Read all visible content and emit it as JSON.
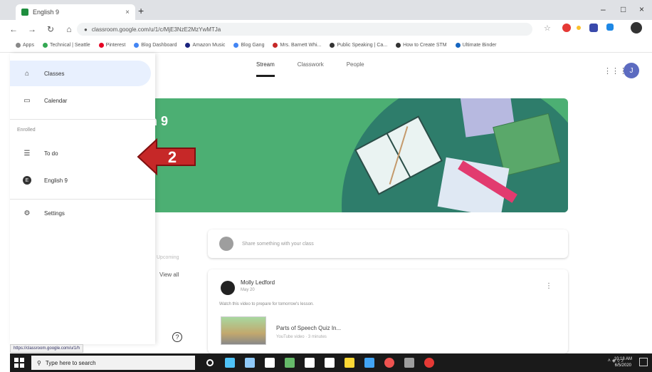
{
  "browser": {
    "tab_title": "English 9",
    "tab_close": "×",
    "new_tab": "+",
    "url": "classroom.google.com/u/1/c/MjE3NzE2MzYwMTJa",
    "bookmarks": [
      {
        "label": "Apps",
        "color": "#888888"
      },
      {
        "label": "Technical | Seattle",
        "color": "#34a853"
      },
      {
        "label": "Pinterest",
        "color": "#e60023"
      },
      {
        "label": "Blog Dashboard",
        "color": "#4285f4"
      },
      {
        "label": "Amazon Music",
        "color": "#1a237e"
      },
      {
        "label": "Blog Gang",
        "color": "#4285f4"
      },
      {
        "label": "Mrs. Barnett Whi...",
        "color": "#c62828"
      },
      {
        "label": "Public Speaking | Ca...",
        "color": "#333333"
      },
      {
        "label": "How to Create STM",
        "color": "#333333"
      },
      {
        "label": "Ultimate Binder",
        "color": "#1565c0"
      }
    ],
    "window_controls": [
      "–",
      "□",
      "×"
    ],
    "profile_letter": ""
  },
  "sidebar": {
    "items": [
      {
        "label": "Classes",
        "icon": "home-icon"
      },
      {
        "label": "Calendar",
        "icon": "calendar-icon"
      },
      {
        "label": "To do",
        "icon": "todo-icon"
      },
      {
        "label": "English 9",
        "icon": "class-avatar",
        "letter": "E"
      },
      {
        "label": "Settings",
        "icon": "settings-icon"
      }
    ],
    "section_label": "Enrolled"
  },
  "classroom": {
    "tabs": [
      "Stream",
      "Classwork",
      "People"
    ],
    "active_tab": "Stream",
    "user_initial": "J",
    "banner_title_partial": "n 9",
    "composer_placeholder": "Share something with your class",
    "upcoming_label": "Upcoming",
    "view_all": "View all",
    "post": {
      "author": "Molly Ledford",
      "date": "May 20",
      "text": "Watch this video to prepare for tomorrow's lesson.",
      "attachment_title": "Parts of Speech Quiz In...",
      "attachment_sub": "YouTube video · 3 minutes"
    },
    "help": "?",
    "status_url": "https://classroom.google.com/u/1/h"
  },
  "annotation": {
    "step_number": "2",
    "color": "#c62828"
  },
  "taskbar": {
    "search_placeholder": "Type here to search",
    "time": "10:18 AM",
    "date": "6/5/2020"
  }
}
